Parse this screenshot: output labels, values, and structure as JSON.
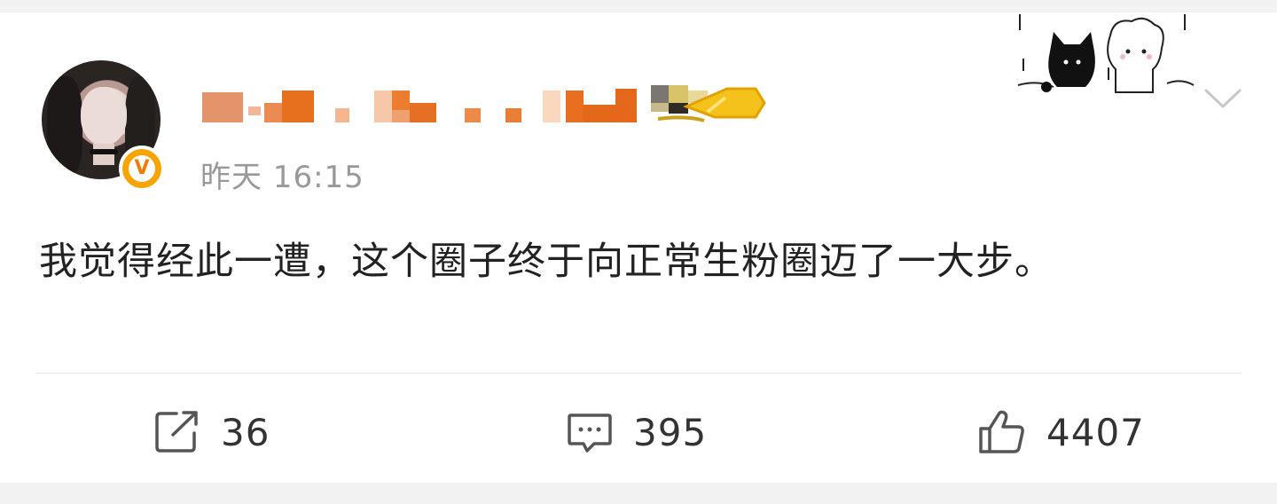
{
  "post": {
    "time": "昨天 16:15",
    "text": "我觉得经此一遭，这个圈子终于向正常生粉圈迈了一大步。"
  },
  "actions": {
    "share_count": "36",
    "comment_count": "395",
    "like_count": "4407"
  },
  "icons": {
    "verified": "verified-v-icon",
    "share": "share-icon",
    "comment": "comment-icon",
    "like": "thumbs-up-icon",
    "more": "chevron-down-icon"
  },
  "colors": {
    "verified_badge": "#f7a400",
    "username_mosaic": "#e8741c",
    "time_text": "#999999",
    "body_text": "#222222",
    "page_bg": "#f2f2f2"
  }
}
